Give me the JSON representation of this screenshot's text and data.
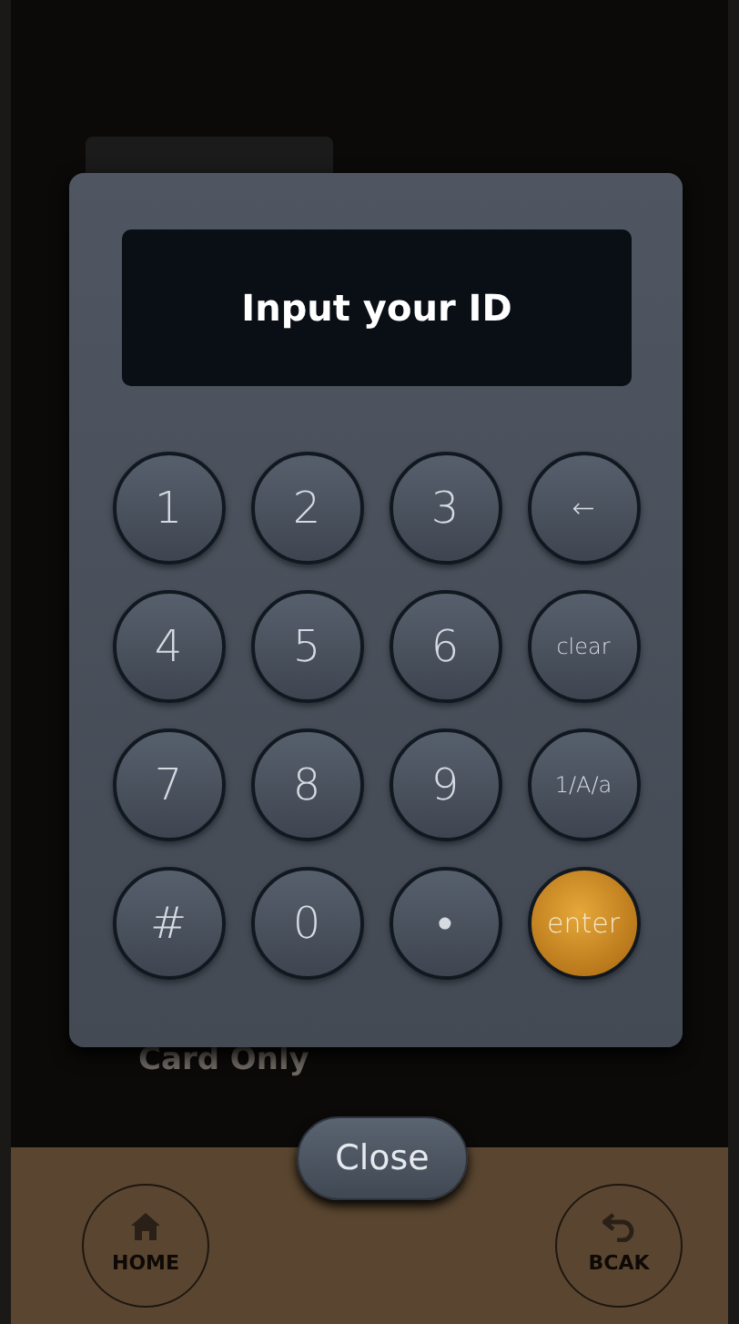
{
  "background": {
    "label": "Card Only"
  },
  "keypad": {
    "display": "Input your ID",
    "keys": [
      {
        "label": "1",
        "kind": "digit"
      },
      {
        "label": "2",
        "kind": "digit"
      },
      {
        "label": "3",
        "kind": "digit"
      },
      {
        "label": "←",
        "kind": "function"
      },
      {
        "label": "4",
        "kind": "digit"
      },
      {
        "label": "5",
        "kind": "digit"
      },
      {
        "label": "6",
        "kind": "digit"
      },
      {
        "label": "clear",
        "kind": "function"
      },
      {
        "label": "7",
        "kind": "digit"
      },
      {
        "label": "8",
        "kind": "digit"
      },
      {
        "label": "9",
        "kind": "digit"
      },
      {
        "label": "1/A/a",
        "kind": "function"
      },
      {
        "label": "#",
        "kind": "digit"
      },
      {
        "label": "0",
        "kind": "digit"
      },
      {
        "label": "•",
        "kind": "digit"
      },
      {
        "label": "enter",
        "kind": "enter"
      }
    ]
  },
  "close_button": "Close",
  "bottom_bar": [
    {
      "label": "HOME",
      "kind": "home"
    },
    {
      "label": "BCAK",
      "kind": "back"
    }
  ]
}
